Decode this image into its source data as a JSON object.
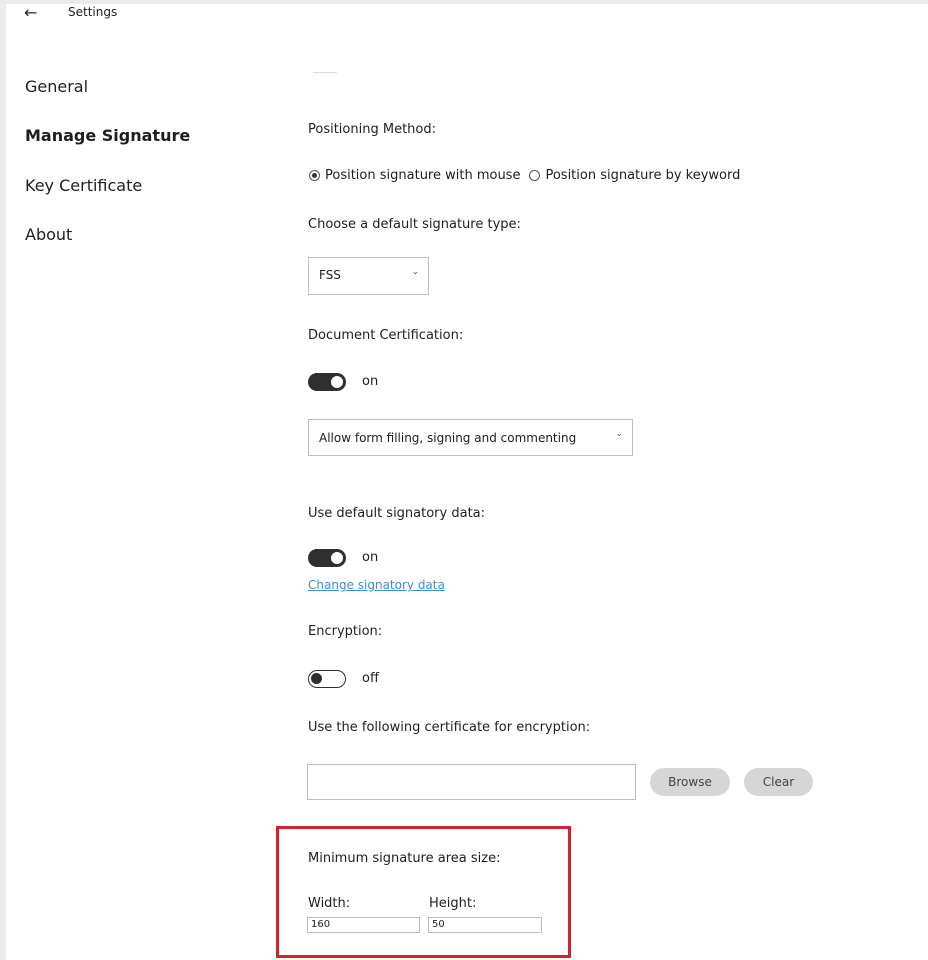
{
  "header": {
    "back_icon": "arrow-left-icon",
    "title": "Settings"
  },
  "sidebar": {
    "items": [
      {
        "label": "General",
        "active": false
      },
      {
        "label": "Manage Signature",
        "active": true
      },
      {
        "label": "Key Certificate",
        "active": false
      },
      {
        "label": "About",
        "active": false
      }
    ]
  },
  "positioning": {
    "label": "Positioning Method:",
    "option_mouse": "Position signature with mouse",
    "option_keyword": "Position signature by keyword",
    "selected": "mouse"
  },
  "signature_type": {
    "label": "Choose a default signature type:",
    "value": "FSS"
  },
  "certification": {
    "label": "Document Certification:",
    "toggle_state": "on",
    "select_value": "Allow form filling, signing and commenting"
  },
  "signatory": {
    "label": "Use default signatory data:",
    "toggle_state": "on",
    "change_link": "Change signatory data"
  },
  "encryption": {
    "label": "Encryption:",
    "toggle_state": "off",
    "certificate_label": "Use the following certificate for encryption:",
    "certificate_value": "",
    "browse_label": "Browse",
    "clear_label": "Clear"
  },
  "min_area": {
    "label": "Minimum signature area size:",
    "width_label": "Width:",
    "height_label": "Height:",
    "width_value": "160",
    "height_value": "50"
  },
  "colors": {
    "accent_link": "#3a8fcf",
    "highlight_border": "#d0222a",
    "toggle_dark": "#2f2f2f"
  }
}
